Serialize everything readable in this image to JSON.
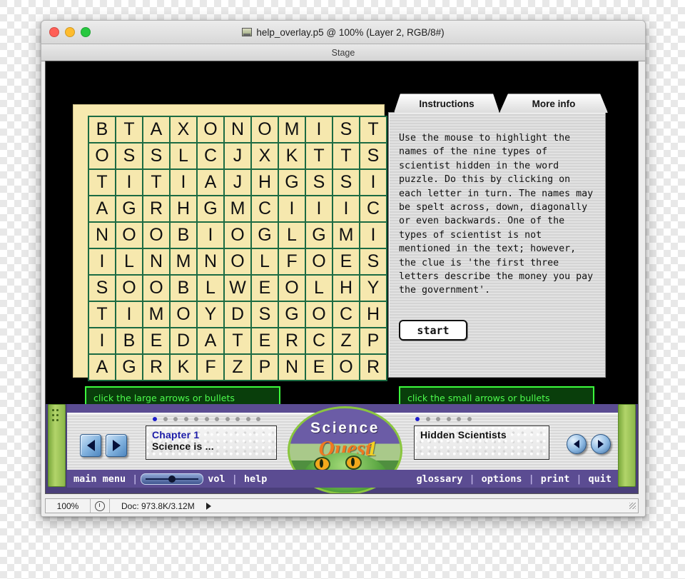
{
  "window": {
    "title": "help_overlay.p5 @ 100% (Layer 2, RGB/8#)",
    "stage_label": "Stage",
    "doc_icon": "document-icon"
  },
  "traffic_lights": [
    {
      "name": "close",
      "color": "#ff5f57"
    },
    {
      "name": "minimize",
      "color": "#febc2e"
    },
    {
      "name": "zoom",
      "color": "#28c840"
    }
  ],
  "puzzle": {
    "rows": [
      [
        "B",
        "T",
        "A",
        "X",
        "O",
        "N",
        "O",
        "M",
        "I",
        "S",
        "T"
      ],
      [
        "O",
        "S",
        "S",
        "L",
        "C",
        "J",
        "X",
        "K",
        "T",
        "T",
        "S"
      ],
      [
        "T",
        "I",
        "T",
        "I",
        "A",
        "J",
        "H",
        "G",
        "S",
        "S",
        "I"
      ],
      [
        "A",
        "G",
        "R",
        "H",
        "G",
        "M",
        "C",
        "I",
        "I",
        "I",
        "C"
      ],
      [
        "N",
        "O",
        "O",
        "B",
        "I",
        "O",
        "G",
        "L",
        "G",
        "M",
        "I"
      ],
      [
        "I",
        "L",
        "N",
        "M",
        "N",
        "O",
        "L",
        "F",
        "O",
        "E",
        "S"
      ],
      [
        "S",
        "O",
        "O",
        "B",
        "L",
        "W",
        "E",
        "O",
        "L",
        "H",
        "Y"
      ],
      [
        "T",
        "I",
        "M",
        "O",
        "Y",
        "D",
        "S",
        "G",
        "O",
        "C",
        "H"
      ],
      [
        "I",
        "B",
        "E",
        "D",
        "A",
        "T",
        "E",
        "R",
        "C",
        "Z",
        "P"
      ],
      [
        "A",
        "G",
        "R",
        "K",
        "F",
        "Z",
        "P",
        "N",
        "E",
        "O",
        "R"
      ]
    ],
    "card_color": "#f7e9af",
    "cell_color": "#f6e8ae",
    "border_color": "#1c6b43"
  },
  "panel": {
    "tabs": [
      {
        "label": "Instructions",
        "active": true
      },
      {
        "label": "More info",
        "active": false
      }
    ],
    "instructions": "Use the mouse to highlight the names of the nine types of scientist hidden in the word puzzle. Do this by clicking on each letter in turn. The names may be spelt across, down, diagonally or even backwards. One of the types of scientist is not mentioned in the text; however, the clue is 'the first three letters describe the money you pay the government'.",
    "start_label": "start"
  },
  "callouts": {
    "left": "click the large arrows or bullets\nto navigate between chapters",
    "right": "click the small arrows or bullets\nto navigate between activities",
    "color": "#4dfd4d",
    "background": "#093e0b"
  },
  "navigation": {
    "chapter": {
      "line1": "Chapter 1",
      "line2": "Science is ...",
      "bullets": 11,
      "active_bullet": 0,
      "prev_label": "previous chapter",
      "next_label": "next chapter"
    },
    "activity": {
      "line1": "Hidden Scientists",
      "line2": "",
      "bullets": 6,
      "active_bullet": 0,
      "prev_label": "previous activity",
      "next_label": "next activity"
    }
  },
  "logo": {
    "line1": "Science",
    "line2": "Quest",
    "number": "1",
    "colors": {
      "science": "#ffffff",
      "quest": "#f07820",
      "number": "#f5d020"
    }
  },
  "menubar": {
    "left": [
      "main menu"
    ],
    "vol_label": "vol",
    "help_label": "help",
    "right": [
      "glossary",
      "options",
      "print",
      "quit"
    ],
    "separator": "|",
    "background": "#5b4c92"
  },
  "statusbar": {
    "zoom": "100%",
    "doc": "Doc: 973.8K/3.12M",
    "clock_icon": "clock-icon",
    "arrow_icon": "triangle-right-icon"
  }
}
